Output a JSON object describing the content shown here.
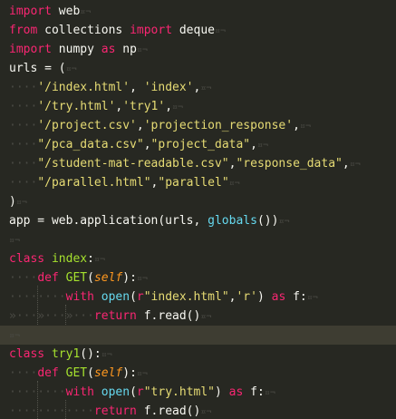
{
  "editor": {
    "language": "python",
    "colors": {
      "background": "#272822",
      "keyword": "#f92672",
      "string": "#e6db74",
      "function_name": "#a6e22e",
      "builtin": "#66d9ef",
      "parameter": "#fd971f",
      "text": "#f8f8f2",
      "whitespace_marker": "#4a4a44"
    },
    "whitespace_glyphs": {
      "space": "·",
      "tab": "»",
      "eol": "¤¬"
    },
    "lines": [
      {
        "tokens": [
          {
            "t": "import",
            "c": "kw"
          },
          {
            "t": " web",
            "c": "plain"
          }
        ]
      },
      {
        "tokens": [
          {
            "t": "from",
            "c": "kw"
          },
          {
            "t": " collections ",
            "c": "plain"
          },
          {
            "t": "import",
            "c": "kw"
          },
          {
            "t": " deque",
            "c": "plain"
          }
        ]
      },
      {
        "tokens": [
          {
            "t": "import",
            "c": "kw"
          },
          {
            "t": " numpy ",
            "c": "plain"
          },
          {
            "t": "as",
            "c": "kw"
          },
          {
            "t": " np",
            "c": "plain"
          }
        ]
      },
      {
        "tokens": [
          {
            "t": "urls = (",
            "c": "plain"
          }
        ]
      },
      {
        "indent": "····",
        "tokens": [
          {
            "t": "'/index.html'",
            "c": "str"
          },
          {
            "t": ", ",
            "c": "plain"
          },
          {
            "t": "'index'",
            "c": "str"
          },
          {
            "t": ",",
            "c": "plain"
          }
        ]
      },
      {
        "indent": "····",
        "tokens": [
          {
            "t": "'/try.html'",
            "c": "str"
          },
          {
            "t": ",",
            "c": "plain"
          },
          {
            "t": "'try1'",
            "c": "str"
          },
          {
            "t": ",",
            "c": "plain"
          }
        ]
      },
      {
        "indent": "····",
        "tokens": [
          {
            "t": "'/project.csv'",
            "c": "str"
          },
          {
            "t": ",",
            "c": "plain"
          },
          {
            "t": "'projection_response'",
            "c": "str"
          },
          {
            "t": ",",
            "c": "plain"
          }
        ]
      },
      {
        "indent": "····",
        "tokens": [
          {
            "t": "\"/pca_data.csv\"",
            "c": "str"
          },
          {
            "t": ",",
            "c": "plain"
          },
          {
            "t": "\"project_data\"",
            "c": "str"
          },
          {
            "t": ",",
            "c": "plain"
          }
        ]
      },
      {
        "indent": "····",
        "tokens": [
          {
            "t": "\"/student-mat-readable.csv\"",
            "c": "str"
          },
          {
            "t": ",",
            "c": "plain"
          },
          {
            "t": "\"response_data\"",
            "c": "str"
          },
          {
            "t": ",",
            "c": "plain"
          }
        ]
      },
      {
        "indent": "····",
        "tokens": [
          {
            "t": "\"/parallel.html\"",
            "c": "str"
          },
          {
            "t": ",",
            "c": "plain"
          },
          {
            "t": "\"parallel\"",
            "c": "str"
          }
        ]
      },
      {
        "tokens": [
          {
            "t": ")",
            "c": "plain"
          }
        ]
      },
      {
        "tokens": [
          {
            "t": "app = web.application(urls, ",
            "c": "plain"
          },
          {
            "t": "globals",
            "c": "bi"
          },
          {
            "t": "())",
            "c": "plain"
          }
        ]
      },
      {
        "tokens": []
      },
      {
        "tokens": [
          {
            "t": "class",
            "c": "kw"
          },
          {
            "t": " ",
            "c": "plain"
          },
          {
            "t": "index",
            "c": "fn"
          },
          {
            "t": ":",
            "c": "plain"
          }
        ]
      },
      {
        "indent": "····",
        "tokens": [
          {
            "t": "def",
            "c": "kw"
          },
          {
            "t": " ",
            "c": "plain"
          },
          {
            "t": "GET",
            "c": "fn"
          },
          {
            "t": "(",
            "c": "plain"
          },
          {
            "t": "self",
            "c": "param"
          },
          {
            "t": "):",
            "c": "plain"
          }
        ]
      },
      {
        "indent": "········",
        "tokens": [
          {
            "t": "with",
            "c": "kw"
          },
          {
            "t": " ",
            "c": "plain"
          },
          {
            "t": "open",
            "c": "bi"
          },
          {
            "t": "(",
            "c": "plain"
          },
          {
            "t": "r",
            "c": "kw"
          },
          {
            "t": "\"index.html\"",
            "c": "str"
          },
          {
            "t": ",",
            "c": "plain"
          },
          {
            "t": "'r'",
            "c": "str"
          },
          {
            "t": ") ",
            "c": "plain"
          },
          {
            "t": "as",
            "c": "kw"
          },
          {
            "t": " f:",
            "c": "plain"
          }
        ]
      },
      {
        "indent": "»···»···»···",
        "tokens": [
          {
            "t": "return",
            "c": "kw"
          },
          {
            "t": " f.read()",
            "c": "plain"
          }
        ]
      },
      {
        "tokens": [],
        "active": true
      },
      {
        "tokens": [
          {
            "t": "class",
            "c": "kw"
          },
          {
            "t": " ",
            "c": "plain"
          },
          {
            "t": "try1",
            "c": "fn"
          },
          {
            "t": "():",
            "c": "plain"
          }
        ]
      },
      {
        "indent": "····",
        "tokens": [
          {
            "t": "def",
            "c": "kw"
          },
          {
            "t": " ",
            "c": "plain"
          },
          {
            "t": "GET",
            "c": "fn"
          },
          {
            "t": "(",
            "c": "plain"
          },
          {
            "t": "self",
            "c": "param"
          },
          {
            "t": "):",
            "c": "plain"
          }
        ]
      },
      {
        "indent": "········",
        "tokens": [
          {
            "t": "with",
            "c": "kw"
          },
          {
            "t": " ",
            "c": "plain"
          },
          {
            "t": "open",
            "c": "bi"
          },
          {
            "t": "(",
            "c": "plain"
          },
          {
            "t": "r",
            "c": "kw"
          },
          {
            "t": "\"try.html\"",
            "c": "str"
          },
          {
            "t": ") ",
            "c": "plain"
          },
          {
            "t": "as",
            "c": "kw"
          },
          {
            "t": " f:",
            "c": "plain"
          }
        ]
      },
      {
        "indent": "············",
        "tokens": [
          {
            "t": "return",
            "c": "kw"
          },
          {
            "t": " f.read()",
            "c": "plain"
          }
        ]
      }
    ]
  }
}
